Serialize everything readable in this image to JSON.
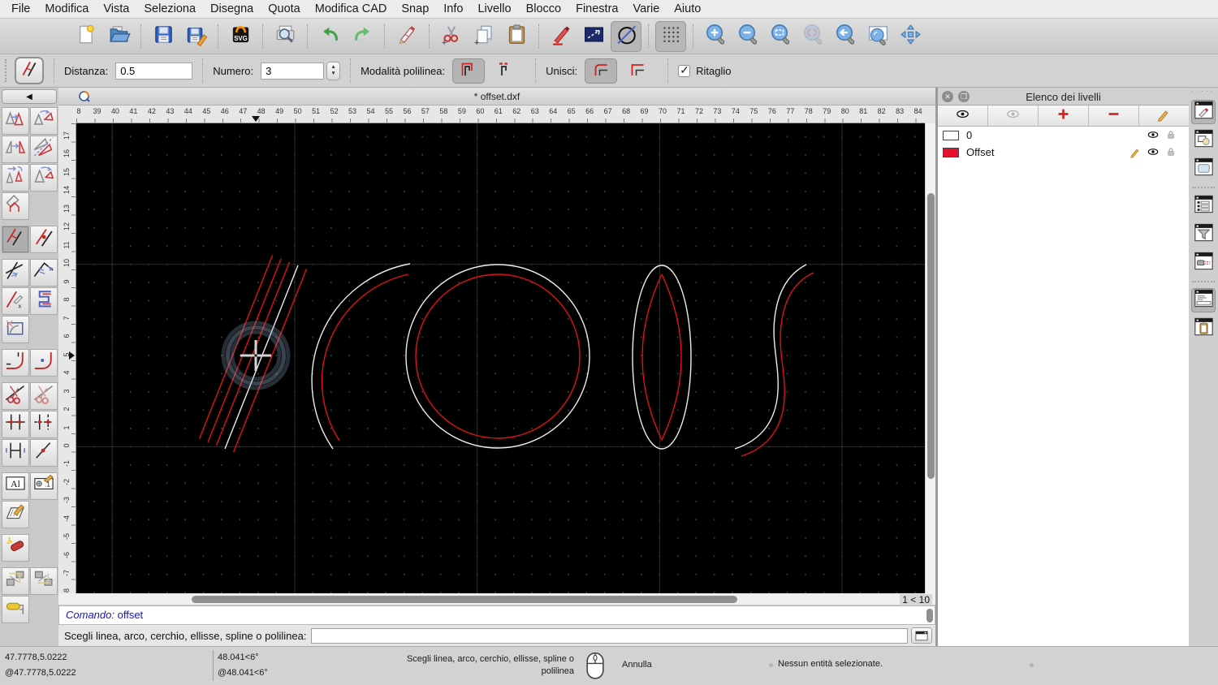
{
  "menu": {
    "items": [
      "File",
      "Modifica",
      "Vista",
      "Seleziona",
      "Disegna",
      "Quota",
      "Modifica CAD",
      "Snap",
      "Info",
      "Livello",
      "Blocco",
      "Finestra",
      "Varie",
      "Aiuto"
    ]
  },
  "toolbar": {
    "buttons": [
      {
        "name": "new-file"
      },
      {
        "name": "open-file",
        "sep_after": true
      },
      {
        "name": "save"
      },
      {
        "name": "save-as",
        "sep_after": true
      },
      {
        "name": "svg-export",
        "sep_after": true
      },
      {
        "name": "print-preview",
        "sep_after": true
      },
      {
        "name": "undo"
      },
      {
        "name": "redo",
        "sep_after": true
      },
      {
        "name": "correction-pen",
        "sep_after": true
      },
      {
        "name": "cut"
      },
      {
        "name": "copy"
      },
      {
        "name": "paste",
        "sep_after": true
      },
      {
        "name": "draw-pen"
      },
      {
        "name": "measure"
      },
      {
        "name": "ellipse-tools",
        "active": true,
        "sep_after": true
      },
      {
        "name": "grid-toggle",
        "active": true,
        "sep_after": true
      },
      {
        "name": "zoom-in"
      },
      {
        "name": "zoom-out"
      },
      {
        "name": "zoom-auto"
      },
      {
        "name": "zoom-selection",
        "disabled": true
      },
      {
        "name": "zoom-previous"
      },
      {
        "name": "zoom-window"
      },
      {
        "name": "pan"
      }
    ]
  },
  "options": {
    "tool_icon": "opt-offset",
    "distance_label": "Distanza:",
    "distance_value": "0.5",
    "number_label": "Numero:",
    "number_value": "3",
    "polyline_mode_label": "Modalità polilinea:",
    "polyline_modes": [
      {
        "name": "mode-poly-solid",
        "pressed": true
      },
      {
        "name": "mode-poly-dashed",
        "pressed": false
      }
    ],
    "join_label": "Unisci:",
    "join_modes": [
      {
        "name": "join-round",
        "pressed": true
      },
      {
        "name": "join-corner",
        "pressed": false
      }
    ],
    "trim_label": "Ritaglio",
    "trim_checked": true
  },
  "palette": {
    "rows": [
      {
        "cells": [
          {
            "name": "move"
          },
          {
            "name": "rotate"
          }
        ]
      },
      {
        "cells": [
          {
            "name": "mirror"
          },
          {
            "name": "mirror-angle"
          }
        ]
      },
      {
        "cells": [
          {
            "name": "move-rotate"
          },
          {
            "name": "rotate-two"
          }
        ]
      },
      {
        "cells": [
          {
            "name": "project"
          }
        ]
      },
      {
        "gap": true
      },
      {
        "cells": [
          {
            "name": "offset",
            "active": true
          },
          {
            "name": "offset-point"
          }
        ]
      },
      {
        "gap": true
      },
      {
        "cells": [
          {
            "name": "trim-extend"
          },
          {
            "name": "polyline-arrows"
          }
        ]
      },
      {
        "cells": [
          {
            "name": "delete-segment"
          },
          {
            "name": "polyline-clip"
          }
        ]
      },
      {
        "cells": [
          {
            "name": "shrink"
          }
        ]
      },
      {
        "gap": true
      },
      {
        "cells": [
          {
            "name": "fillet"
          },
          {
            "name": "fillet-radius"
          }
        ]
      },
      {
        "gap": true
      },
      {
        "cells": [
          {
            "name": "trim-scissors"
          },
          {
            "name": "trim-both"
          }
        ]
      },
      {
        "cells": [
          {
            "name": "divide"
          },
          {
            "name": "divide-dashed"
          }
        ]
      },
      {
        "cells": [
          {
            "name": "stretch"
          },
          {
            "name": "break-point"
          }
        ]
      },
      {
        "gap": true
      },
      {
        "cells": [
          {
            "name": "text-edit"
          },
          {
            "name": "dimension-edit"
          }
        ]
      },
      {
        "cells": [
          {
            "name": "hatch-edit"
          }
        ]
      },
      {
        "gap": true
      },
      {
        "cells": [
          {
            "name": "explode"
          }
        ]
      },
      {
        "gap": true
      },
      {
        "cells": [
          {
            "name": "block-insert"
          },
          {
            "name": "block-edit"
          }
        ]
      },
      {
        "cells": [
          {
            "name": "paint"
          }
        ]
      }
    ]
  },
  "doc": {
    "title": "* offset.dxf",
    "zoom_indicator": "1 < 10"
  },
  "rulers": {
    "horizontal": [
      "8",
      "39",
      "40",
      "41",
      "42",
      "43",
      "44",
      "45",
      "46",
      "47",
      "48",
      "49",
      "50",
      "51",
      "52",
      "53",
      "54",
      "55",
      "56",
      "57",
      "58",
      "59",
      "60",
      "61",
      "62",
      "63",
      "64",
      "65",
      "66",
      "67",
      "68",
      "69",
      "70",
      "71",
      "72",
      "73",
      "74",
      "75",
      "76",
      "77",
      "78",
      "79",
      "80",
      "81",
      "82",
      "83",
      "84"
    ],
    "vertical": [
      "17",
      "16",
      "15",
      "14",
      "13",
      "12",
      "11",
      "10",
      "9",
      "8",
      "7",
      "6",
      "5",
      "4",
      "3",
      "2",
      "1",
      "0",
      "-1",
      "-2",
      "-3",
      "-4",
      "-5",
      "-6",
      "-7",
      "-8"
    ]
  },
  "layers_panel": {
    "title": "Elenco dei livelli",
    "toolbar": [
      {
        "name": "show-all"
      },
      {
        "name": "hide-all"
      },
      {
        "name": "add-layer"
      },
      {
        "name": "remove-layer"
      },
      {
        "name": "edit-layer"
      }
    ],
    "layers": [
      {
        "name": "0",
        "color": "#ffffff",
        "visible": true,
        "locked_icon": true,
        "editing": false
      },
      {
        "name": "Offset",
        "color": "#e8112d",
        "visible": true,
        "locked_icon": true,
        "editing": true
      }
    ]
  },
  "dock": {
    "buttons": [
      {
        "name": "layer-list",
        "active": true
      },
      {
        "name": "block-list"
      },
      {
        "name": "library-browser",
        "sep_after": true
      },
      {
        "name": "property-editor"
      },
      {
        "name": "selection-filter"
      },
      {
        "name": "projection",
        "sep_after": true
      },
      {
        "name": "command-line",
        "active": true
      },
      {
        "name": "clipboard"
      }
    ]
  },
  "command": {
    "prompt_prefix": "Comando:",
    "last_command": " offset",
    "input_label": "Scegli linea, arco, cerchio, ellisse, spline o polilinea:",
    "input_value": ""
  },
  "status": {
    "abs_cartesian": "47.7778,5.0222",
    "rel_cartesian": "@47.7778,5.0222",
    "abs_polar": "48.041<6°",
    "rel_polar": "@48.041<6°",
    "left_hint": "Scegli linea, arco, cerchio, ellisse, spline o polilinea",
    "right_hint": "Annulla",
    "selection": "Nessun entità selezionate."
  },
  "canvas": {
    "background": "#000000",
    "original_color": "#ededed",
    "offset_color": "#e01212",
    "entities": [
      "offset-parallel-lines",
      "original-line",
      "offset-arc",
      "original-arc",
      "offset-circle",
      "original-circle",
      "offset-ellipse",
      "original-ellipse",
      "offset-spline",
      "original-spline"
    ]
  }
}
